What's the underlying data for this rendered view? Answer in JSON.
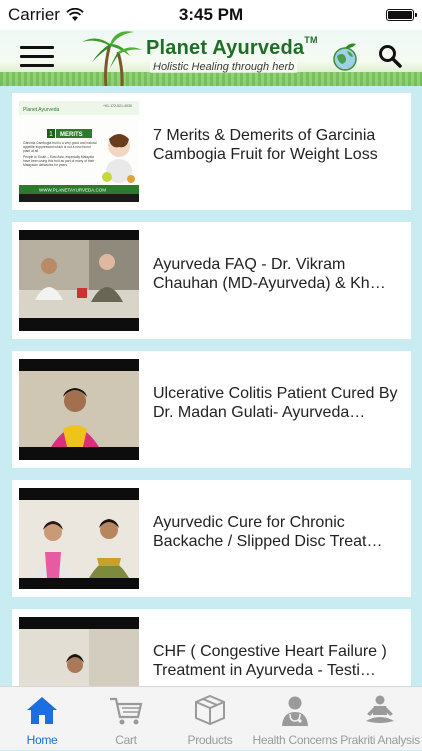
{
  "status_bar": {
    "carrier": "Carrier",
    "time": "3:45 PM",
    "battery_level": 1.0
  },
  "header": {
    "brand": "Planet Ayurveda",
    "trademark": "TM",
    "tagline": "Holistic Healing through herb",
    "menu_icon": "hamburger-menu-icon",
    "search_icon": "search-icon"
  },
  "videos": [
    {
      "title": "7 Merits & Demerits of Garcinia Cambogia Fruit for Weight Loss",
      "thumb": "slide"
    },
    {
      "title": "Ayurveda FAQ - Dr. Vikram Chauhan (MD-Ayurveda) & Kh…",
      "thumb": "video"
    },
    {
      "title": "Ulcerative Colitis Patient Cured By Dr. Madan Gulati- Ayurveda…",
      "thumb": "video"
    },
    {
      "title": "Ayurvedic Cure for Chronic Backache / Slipped Disc Treat…",
      "thumb": "video"
    },
    {
      "title": "CHF ( Congestive Heart Failure ) Treatment in Ayurveda - Testi…",
      "thumb": "video"
    }
  ],
  "thumb_text": {
    "brand": "Planet Ayurveda",
    "phone": "+91-172-521-4030",
    "merits_number": "1",
    "merits": "MERITS",
    "point_1": "Garcinia Cambogia fruit is a very good and natural appetite suppressant which is not a new found plant at all.",
    "point_2": "People in South – East Asia, especially Malaysia have been using this fruit as part of many of their Malaysian delicacies for years.",
    "website": "WWW.PLANETAYURVEDA.COM"
  },
  "tabs": [
    {
      "label": "Home",
      "icon": "home-icon",
      "active": true
    },
    {
      "label": "Cart",
      "icon": "cart-icon",
      "active": false
    },
    {
      "label": "Products",
      "icon": "box-icon",
      "active": false
    },
    {
      "label": "Health Concerns",
      "icon": "doctor-icon",
      "active": false
    },
    {
      "label": "Prakriti Analysis",
      "icon": "meditation-icon",
      "active": false
    }
  ],
  "colors": {
    "background": "#c8ecf2",
    "brand_green": "#1f6e27",
    "tab_active": "#1c6fe0",
    "tab_inactive": "#9a9a9a"
  }
}
